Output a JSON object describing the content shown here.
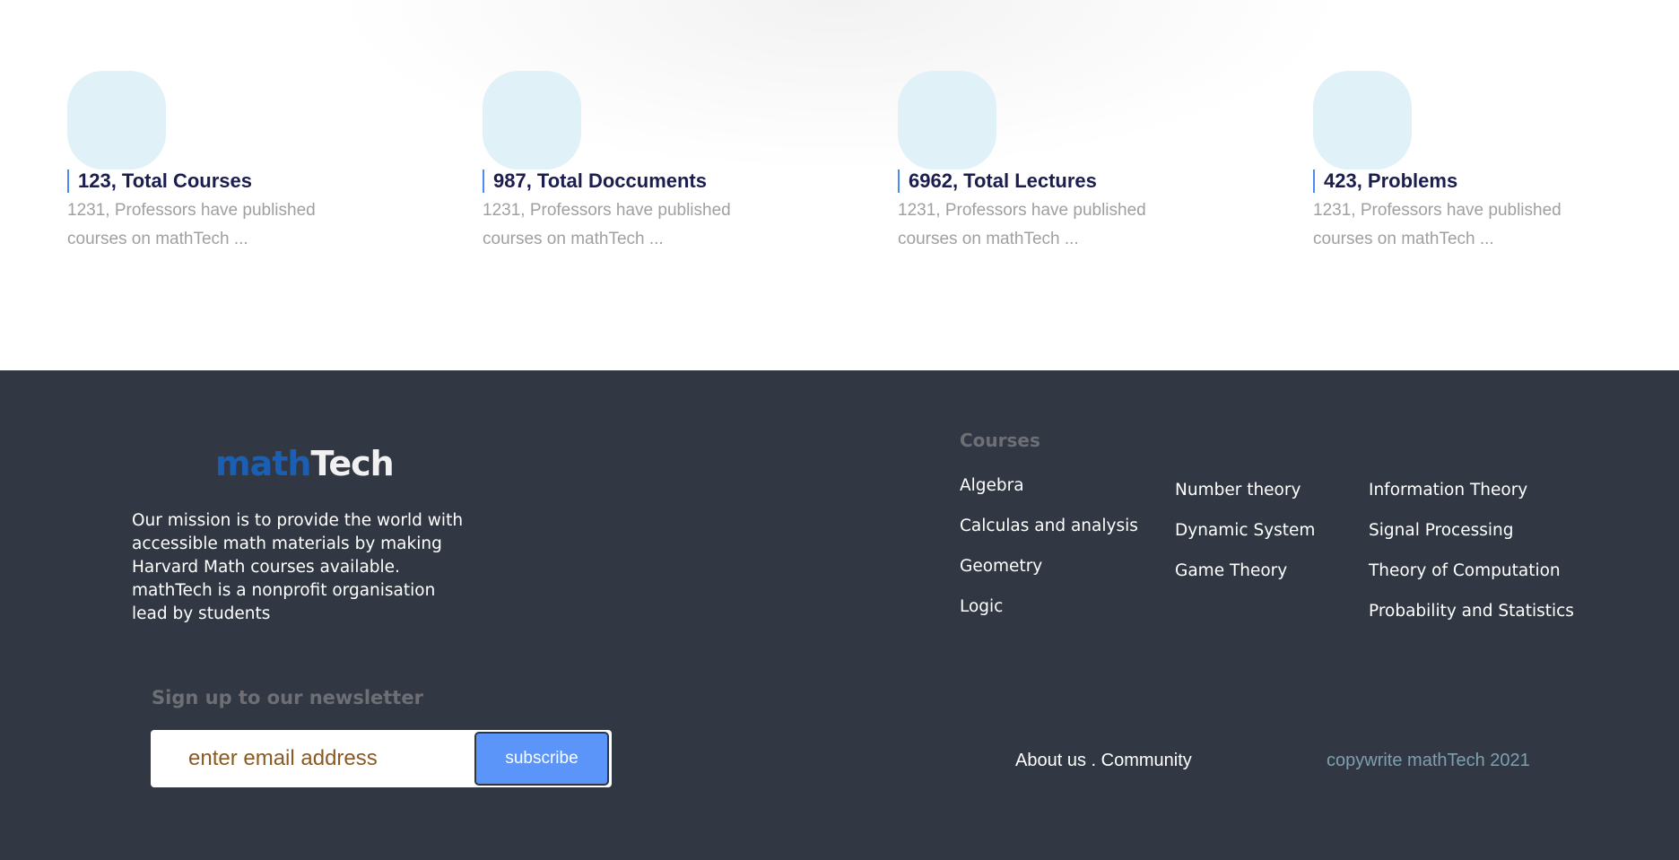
{
  "stats": [
    {
      "title": "123, Total Courses",
      "desc": "1231, Professors have published courses on mathTech ..."
    },
    {
      "title": "987, Total Doccuments",
      "desc": "1231, Professors have published courses on mathTech ..."
    },
    {
      "title": "6962, Total Lectures",
      "desc": "1231, Professors have published courses on mathTech ..."
    },
    {
      "title": "423, Problems",
      "desc": "1231, Professors have published courses on mathTech ..."
    }
  ],
  "footer": {
    "logo_part1": "math",
    "logo_part2": "Tech",
    "mission": "Our mission is to provide the world with accessible math materials by making Harvard Math courses available. mathTech is a nonprofit organisation lead by students",
    "courses_heading": "Courses",
    "courses_col1": [
      "Algebra",
      "Calculas and analysis",
      "Geometry",
      "Logic"
    ],
    "courses_col2": [
      "Number theory",
      "Dynamic System",
      "Game Theory"
    ],
    "courses_col3": [
      "Information Theory",
      "Signal Processing",
      "Theory of Computation",
      "Probability and Statistics"
    ],
    "newsletter_heading": "Sign up to our newsletter",
    "email_placeholder": "enter email address",
    "subscribe_label": "subscribe",
    "about_label": "About us",
    "separator": " . ",
    "community_label": "Community",
    "copyright": "copywrite mathTech 2021"
  },
  "colors": {
    "footer_bg": "#313843",
    "accent_blue": "#5b95fa",
    "logo_blue": "#1a5fb4",
    "stat_blob": "#e1f1f8"
  }
}
